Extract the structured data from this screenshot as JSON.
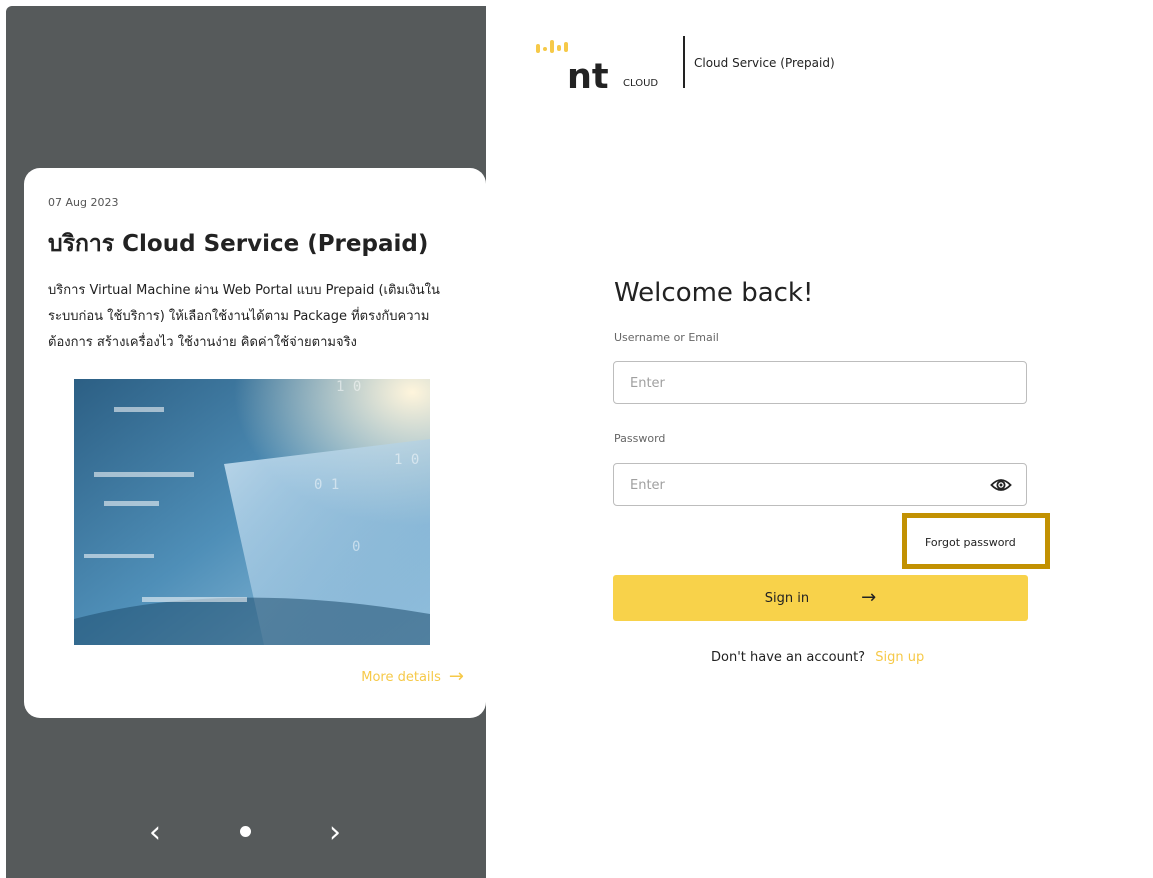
{
  "brand": {
    "logo_text": "nt",
    "logo_cloud": "CLOUD",
    "subtitle": "Cloud Service (Prepaid)",
    "accent_color": "#f8d24a"
  },
  "news": {
    "date": "07 Aug 2023",
    "title": "บริการ Cloud Service (Prepaid)",
    "description": "บริการ Virtual Machine ผ่าน Web Portal แบบ Prepaid (เติมเงินในระบบก่อน ใช้บริการ) ให้เลือกใช้งานได้ตาม Package ที่ตรงกับความต้องการ สร้างเครื่องไว ใช้งานง่าย คิดค่าใช้จ่ายตามจริง",
    "more_details": "More details",
    "image_icon": "cloud-technology-image"
  },
  "carousel": {
    "prev_icon": "chevron-left-icon",
    "next_icon": "chevron-right-icon",
    "prev": "‹",
    "next": "›"
  },
  "login": {
    "heading": "Welcome back!",
    "username_label": "Username or Email",
    "username_placeholder": "Enter",
    "password_label": "Password",
    "password_placeholder": "Enter",
    "forgot_password": "Forgot password",
    "signin_label": "Sign in",
    "signup_prompt": "Don't have an account?",
    "signup_link": "Sign up",
    "highlight_color": "#c29102"
  }
}
